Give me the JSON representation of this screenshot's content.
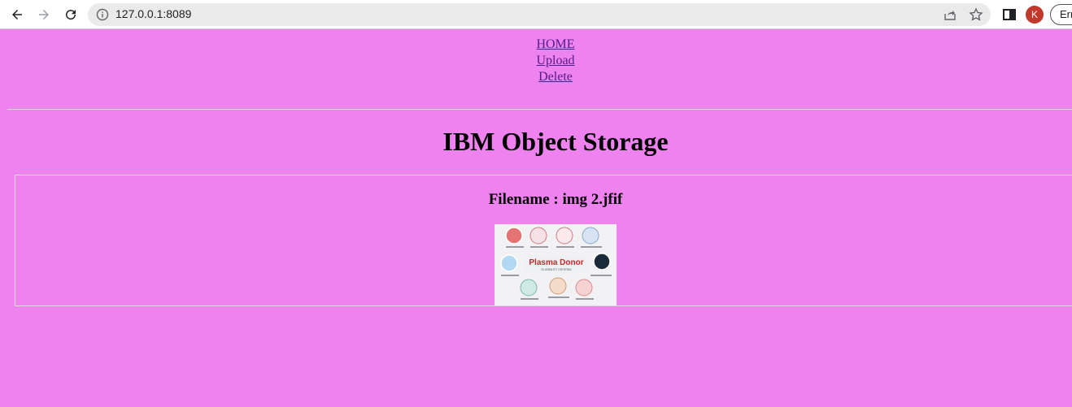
{
  "browser": {
    "url": "127.0.0.1:8089",
    "profile_initial": "K",
    "pill_text": "Err",
    "icons": [
      "back-arrow-icon",
      "forward-arrow-icon",
      "reload-icon",
      "info-icon",
      "share-icon",
      "star-icon",
      "side-panel-icon"
    ]
  },
  "nav": {
    "home": "HOME",
    "upload": "Upload",
    "delete": "Delete"
  },
  "main": {
    "title": "IBM Object Storage",
    "files": [
      {
        "filename": "Filename : img 2.jfif"
      }
    ],
    "thumbnail_banner": "Plasma Donor",
    "thumbnail_subtext": "ELIGIBILITY CRITERIA"
  },
  "colors": {
    "page_background": "#ee82ee",
    "link": "#551a8b"
  }
}
